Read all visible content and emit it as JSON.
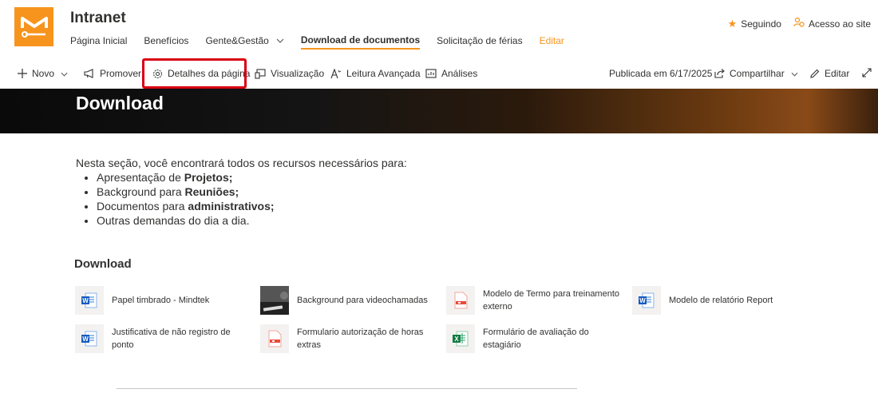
{
  "header": {
    "site_title": "Intranet",
    "nav": [
      "Página Inicial",
      "Benefícios",
      "Gente&Gestão",
      "Download de documentos",
      "Solicitação de férias",
      "Editar"
    ],
    "following_label": "Seguindo",
    "site_access_label": "Acesso ao site"
  },
  "commandbar": {
    "new_label": "Novo",
    "promote_label": "Promover",
    "page_details_label": "Detalhes da página",
    "view_label": "Visualização",
    "immersive_reader_label": "Leitura Avançada",
    "analytics_label": "Análises",
    "published_label": "Publicada em 6/17/2025",
    "share_label": "Compartilhar",
    "edit_label": "Editar"
  },
  "hero": {
    "title": "Download"
  },
  "intro": {
    "text": "Nesta seção, você encontrará todos os recursos necessários para:",
    "bullets": [
      {
        "prefix": "Apresentação de ",
        "bold": "Projetos;"
      },
      {
        "prefix": "Background para ",
        "bold": "Reuniões;"
      },
      {
        "prefix": "Documentos para ",
        "bold": "administrativos;"
      },
      {
        "prefix": "Outras demandas do dia a dia.",
        "bold": ""
      }
    ]
  },
  "downloads": {
    "title": "Download",
    "files": [
      {
        "name": "Papel timbrado - Mindtek",
        "icon": "word-icon"
      },
      {
        "name": "Background para videochamadas",
        "icon": "image-thumbnail"
      },
      {
        "name": "Modelo de Termo para treinamento externo",
        "icon": "pdf-icon"
      },
      {
        "name": "Modelo de relatório Report",
        "icon": "word-icon"
      },
      {
        "name": "Justificativa de não registro de ponto",
        "icon": "word-icon"
      },
      {
        "name": "Formulario autorização de horas extras",
        "icon": "pdf-icon"
      },
      {
        "name": "Formulário de avaliação do estagiário",
        "icon": "excel-icon"
      }
    ]
  }
}
